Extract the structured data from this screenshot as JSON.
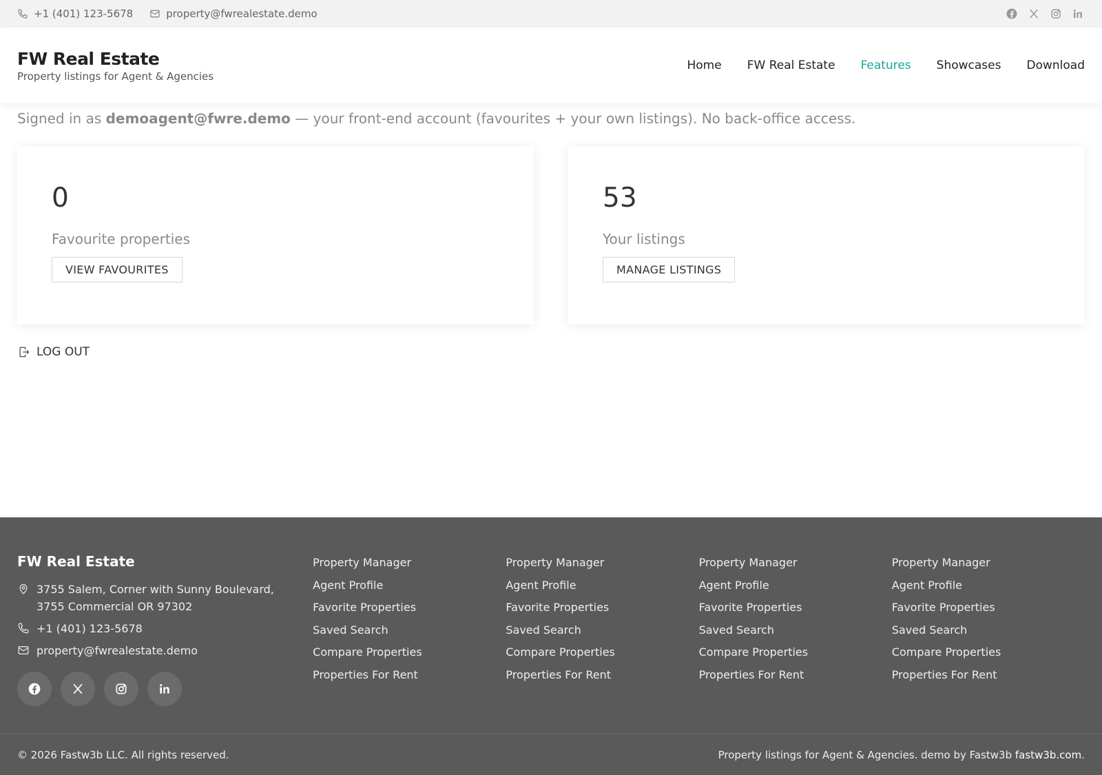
{
  "topbar": {
    "phone": "+1 (401) 123-5678",
    "email": "property@fwrealestate.demo",
    "socials": [
      "facebook-icon",
      "x-icon",
      "instagram-icon",
      "linkedin-icon"
    ]
  },
  "header": {
    "brand": "FW Real Estate",
    "tagline": "Property listings for Agent & Agencies",
    "nav": [
      {
        "label": "Home"
      },
      {
        "label": "FW Real Estate"
      },
      {
        "label": "Features",
        "active": true
      },
      {
        "label": "Showcases"
      },
      {
        "label": "Download"
      }
    ]
  },
  "account": {
    "signed_prefix": "Signed in as",
    "user": "demoagent@fwre.demo",
    "signed_suffix": "— your front-end account (favourites + your own listings). No back-office access."
  },
  "cards": [
    {
      "count": "0",
      "label": "Favourite properties",
      "button": "VIEW FAVOURITES"
    },
    {
      "count": "53",
      "label": "Your listings",
      "button": "MANAGE LISTINGS"
    }
  ],
  "logout_label": "LOG OUT",
  "footer": {
    "title": "FW Real Estate",
    "address_line1": "3755 Salem, Corner with Sunny Boulevard,",
    "address_line2": "3755 Commercial OR 97302",
    "phone": "+1 (401) 123-5678",
    "email": "property@fwrealestate.demo",
    "columns": [
      [
        "Property Manager",
        "Agent Profile",
        "Favorite Properties",
        "Saved Search",
        "Compare Properties",
        "Properties For Rent"
      ],
      [
        "Property Manager",
        "Agent Profile",
        "Favorite Properties",
        "Saved Search",
        "Compare Properties",
        "Properties For Rent"
      ],
      [
        "Property Manager",
        "Agent Profile",
        "Favorite Properties",
        "Saved Search",
        "Compare Properties",
        "Properties For Rent"
      ],
      [
        "Property Manager",
        "Agent Profile",
        "Favorite Properties",
        "Saved Search",
        "Compare Properties",
        "Properties For Rent"
      ]
    ],
    "copyright": "© 2026 Fastw3b LLC. All rights reserved.",
    "credit_text": "Property listings for Agent & Agencies. demo by Fastw3b",
    "credit_domain": "fastw3b.com",
    "credit_end": "."
  },
  "colors": {
    "accent": "#14a89a",
    "footer_bg": "#5a5a5a",
    "topbar_bg": "#f2f2f2"
  }
}
